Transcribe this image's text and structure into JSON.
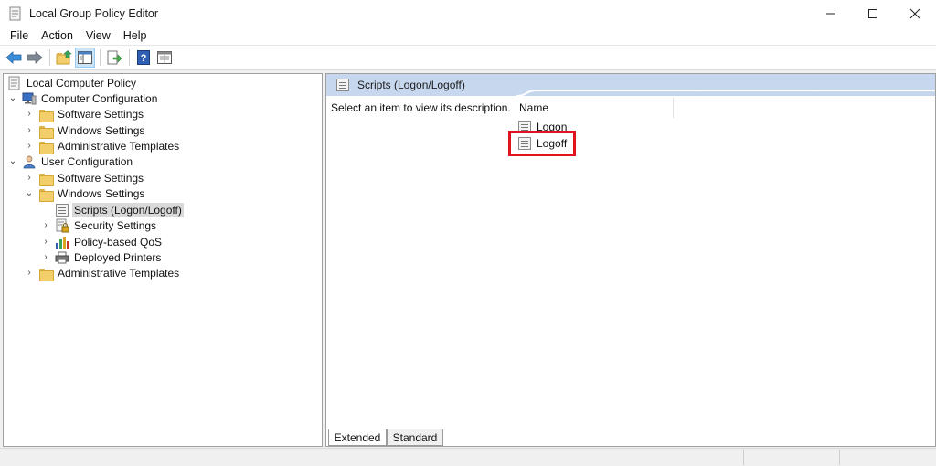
{
  "window": {
    "title": "Local Group Policy Editor",
    "minimize_icon": "minimize-icon",
    "maximize_icon": "maximize-icon",
    "close_icon": "close-icon"
  },
  "menu": [
    "File",
    "Action",
    "View",
    "Help"
  ],
  "toolbar": {
    "icons": [
      "back-arrow-icon",
      "forward-arrow-icon",
      "up-folder-icon",
      "show-hide-console-tree-icon",
      "export-list-icon",
      "help-icon",
      "properties-icon"
    ]
  },
  "tree": {
    "root": "Local Computer Policy",
    "computer_configuration": "Computer Configuration",
    "cc_software_settings": "Software Settings",
    "cc_windows_settings": "Windows Settings",
    "cc_administrative_templates": "Administrative Templates",
    "user_configuration": "User Configuration",
    "uc_software_settings": "Software Settings",
    "uc_windows_settings": "Windows Settings",
    "scripts": "Scripts (Logon/Logoff)",
    "security_settings": "Security Settings",
    "policy_based_qos": "Policy-based QoS",
    "deployed_printers": "Deployed Printers",
    "uc_administrative_templates": "Administrative Templates"
  },
  "details": {
    "header": "Scripts (Logon/Logoff)",
    "description": "Select an item to view its description.",
    "column_name": "Name",
    "items": [
      "Logon",
      "Logoff"
    ],
    "highlighted_item": "Logoff",
    "highlight_color": "#e0141e"
  },
  "tabs": {
    "extended": "Extended",
    "standard": "Standard"
  }
}
